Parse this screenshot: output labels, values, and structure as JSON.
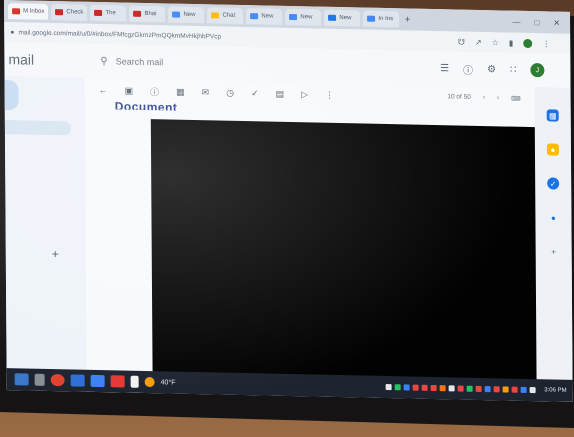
{
  "browser": {
    "tabs": [
      {
        "label": "M Inbox",
        "color": "#d93025"
      },
      {
        "label": "Check",
        "color": "#c5221f"
      },
      {
        "label": "The",
        "color": "#c5221f"
      },
      {
        "label": "Bhai",
        "color": "#c5221f"
      },
      {
        "label": "New",
        "color": "#4285f4"
      },
      {
        "label": "Chat",
        "color": "#fbbc04"
      },
      {
        "label": "New",
        "color": "#4285f4"
      },
      {
        "label": "New",
        "color": "#4285f4"
      },
      {
        "label": "New",
        "color": "#1a73e8"
      },
      {
        "label": "In Ins",
        "color": "#4285f4"
      }
    ],
    "new_tab": "+",
    "url": "mail.google.com/mail/u/0/#inbox/FMfcgzGkrnzPmQQkmMvHkjhbPVcp"
  },
  "gmail": {
    "brand": "mail",
    "search_placeholder": "Search mail",
    "filter_icon": "sliders-icon",
    "avatar_letter": "J",
    "pager": "10 of 50",
    "subject": "Document"
  },
  "nav": {
    "add_label": "+"
  },
  "taskbar": {
    "weather": "40°F",
    "time": "3:06 PM"
  },
  "colors": {
    "accent": "#1a73e8",
    "avatar": "#2e7d32",
    "video": "#020202"
  }
}
